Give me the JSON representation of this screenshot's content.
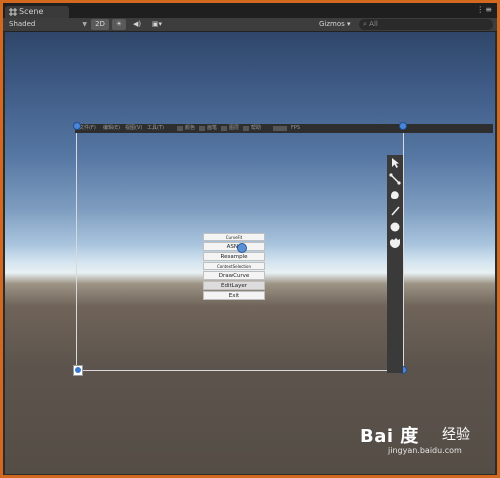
{
  "window": {
    "tab_title": "Scene",
    "tab_icon": "scene-grid-icon",
    "menu_icon": "more-options-icon"
  },
  "toolbar": {
    "shading_mode": "Shaded",
    "btn_2d": "2D",
    "lighting_icon": "sun-icon",
    "audio_icon": "audio-icon",
    "effects_icon": "image-effects-icon",
    "gizmos_label": "Gizmos",
    "search_placeholder": "All"
  },
  "app_menu": {
    "items": [
      "文件(F)",
      "编辑(E)",
      "视图(V)",
      "工具(T)"
    ],
    "extra_items": [
      "颜色",
      "画笔",
      "图层",
      "帮助",
      "FPS"
    ]
  },
  "right_tools": [
    "pointer-icon",
    "line-tool-icon",
    "blob-brush-icon",
    "pencil-icon",
    "dot-brush-icon",
    "fur-brush-icon"
  ],
  "popup_menu": {
    "items": [
      "CurveFit",
      "ASNe",
      "Resample",
      "ContextSelection",
      "DrawCurve",
      "EditLayer",
      "Exit"
    ]
  },
  "watermark": {
    "brand": "Bai 度",
    "suffix": "经验",
    "url": "jingyan.baidu.com"
  },
  "colors": {
    "accent": "#d2691e",
    "handle": "#4a86d8"
  }
}
